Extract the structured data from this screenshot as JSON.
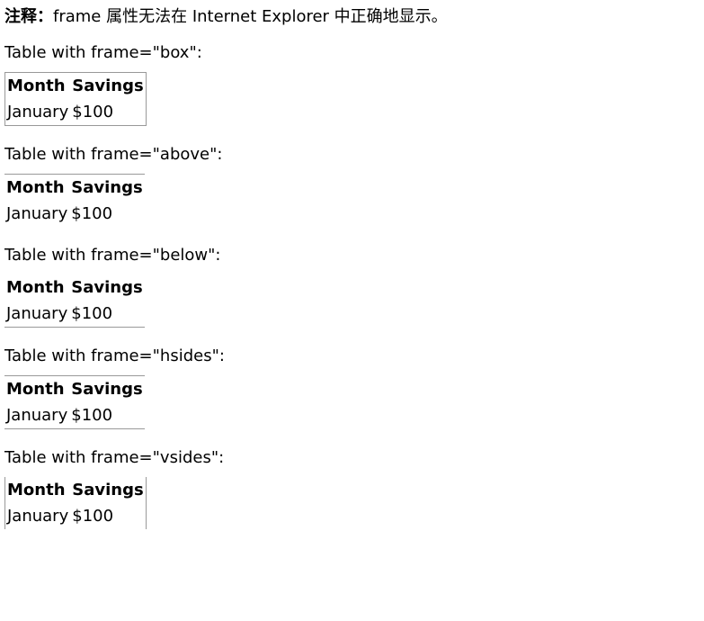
{
  "note": {
    "label": "注释：",
    "text": "frame 属性无法在 Internet Explorer 中正确地显示。"
  },
  "tables": [
    {
      "caption": "Table with frame=\"box\":",
      "headers": [
        "Month",
        "Savings"
      ],
      "row": [
        "January",
        "$100"
      ]
    },
    {
      "caption": "Table with frame=\"above\":",
      "headers": [
        "Month",
        "Savings"
      ],
      "row": [
        "January",
        "$100"
      ]
    },
    {
      "caption": "Table with frame=\"below\":",
      "headers": [
        "Month",
        "Savings"
      ],
      "row": [
        "January",
        "$100"
      ]
    },
    {
      "caption": "Table with frame=\"hsides\":",
      "headers": [
        "Month",
        "Savings"
      ],
      "row": [
        "January",
        "$100"
      ]
    },
    {
      "caption": "Table with frame=\"vsides\":",
      "headers": [
        "Month",
        "Savings"
      ],
      "row": [
        "January",
        "$100"
      ]
    }
  ],
  "colors": {
    "border": "#999999",
    "text": "#000000",
    "background": "#ffffff"
  }
}
